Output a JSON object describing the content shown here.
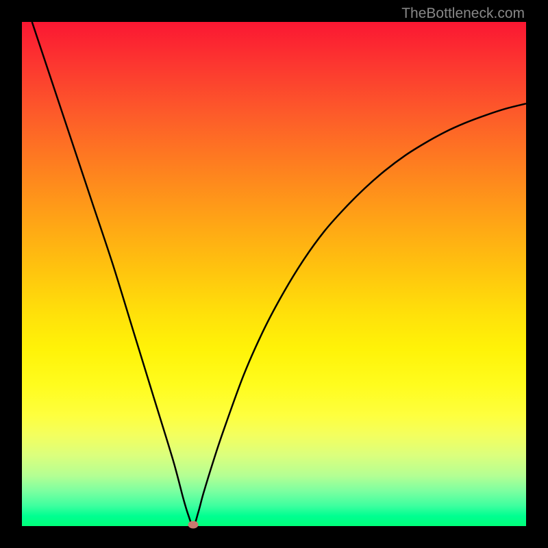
{
  "watermark": "TheBottleneck.com",
  "chart_data": {
    "type": "line",
    "title": "",
    "xlabel": "",
    "ylabel": "",
    "xlim": [
      0,
      100
    ],
    "ylim": [
      0,
      100
    ],
    "optimal_point": {
      "x": 34,
      "y": 0
    },
    "series": [
      {
        "name": "bottleneck-curve",
        "x": [
          2,
          6,
          10,
          14,
          18,
          22,
          26,
          30,
          32,
          33,
          34,
          35,
          36,
          38,
          40,
          44,
          48,
          52,
          56,
          60,
          64,
          68,
          72,
          76,
          80,
          84,
          88,
          92,
          96,
          100
        ],
        "values": [
          100,
          88,
          76,
          64,
          52,
          39,
          26,
          13,
          5.5,
          2.2,
          0,
          2.8,
          6.5,
          13,
          19,
          30,
          39,
          46.5,
          53,
          58.5,
          63,
          67,
          70.5,
          73.5,
          76,
          78.2,
          80,
          81.5,
          82.8,
          83.8
        ]
      }
    ]
  }
}
